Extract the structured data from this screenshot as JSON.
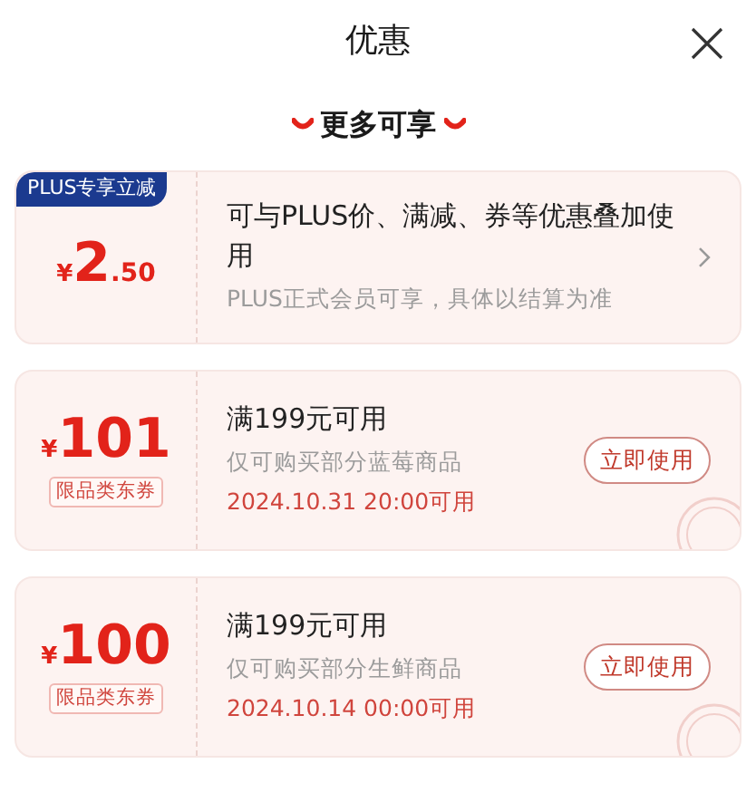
{
  "header": {
    "title": "优惠"
  },
  "section": {
    "title": "更多可享"
  },
  "offers": [
    {
      "kind": "plus",
      "tag": "PLUS专享立减",
      "currency": "¥",
      "amount": "2",
      "decimal": ".50",
      "title": "可与PLUS价、满减、券等优惠叠加使用",
      "note": "PLUS正式会员可享，具体以结算为准"
    },
    {
      "kind": "coupon",
      "currency": "¥",
      "amount": "101",
      "label": "限品类东券",
      "title": "满199元可用",
      "note": "仅可购买部分蓝莓商品",
      "time": "2024.10.31 20:00可用",
      "button": "立即使用"
    },
    {
      "kind": "coupon",
      "currency": "¥",
      "amount": "100",
      "label": "限品类东券",
      "title": "满199元可用",
      "note": "仅可购买部分生鲜商品",
      "time": "2024.10.14 00:00可用",
      "button": "立即使用"
    }
  ]
}
